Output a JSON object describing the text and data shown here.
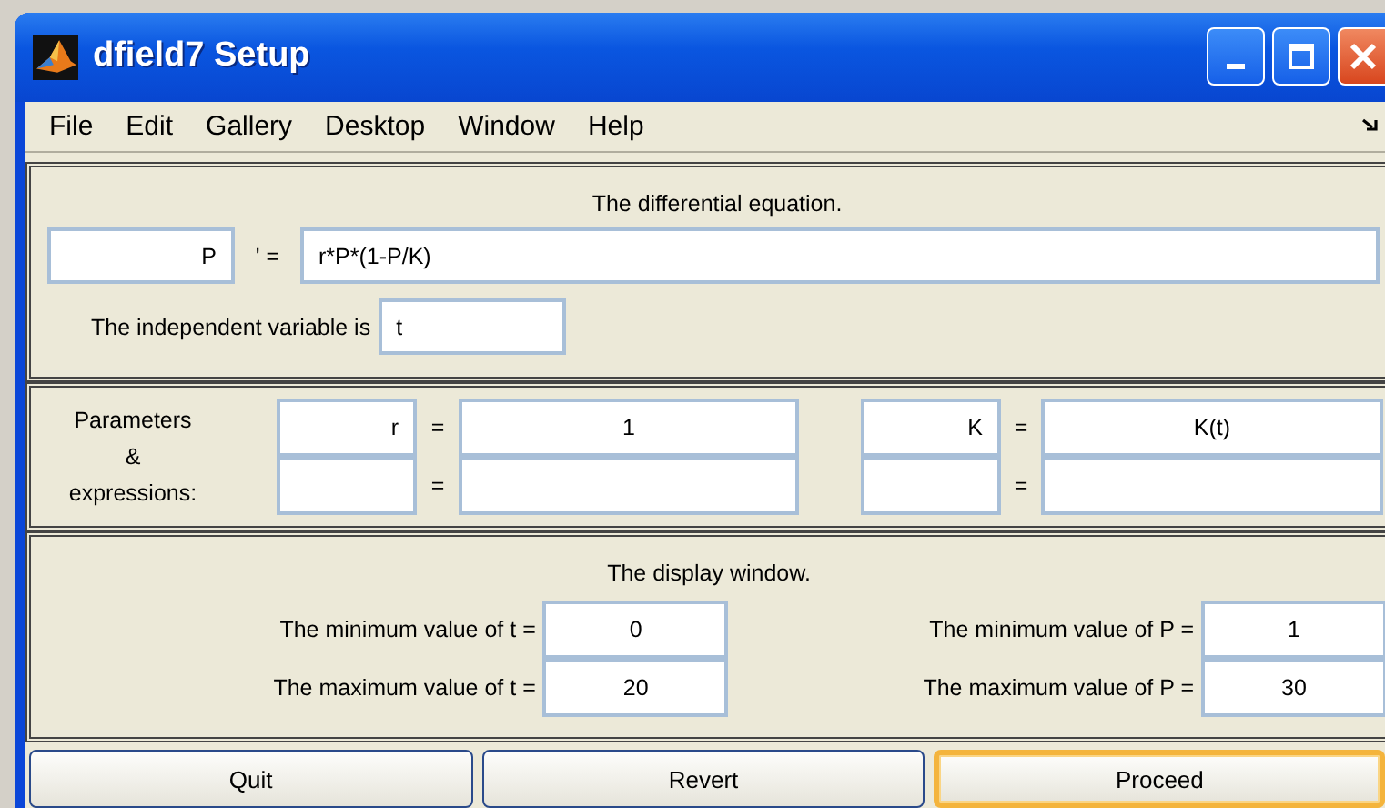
{
  "window": {
    "title": "dfield7 Setup"
  },
  "menu": [
    "File",
    "Edit",
    "Gallery",
    "Desktop",
    "Window",
    "Help"
  ],
  "equation": {
    "title": "The differential equation.",
    "variable": "P",
    "prime": "' =",
    "rhs": "r*P*(1-P/K)",
    "independent_label": "The independent variable is",
    "independent": "t"
  },
  "parameters": {
    "label_1": "Parameters",
    "label_2": "&",
    "label_3": "expressions:",
    "eq": "=",
    "rows": [
      [
        {
          "name": "r",
          "value": "1"
        },
        {
          "name": "K",
          "value": "K(t)"
        }
      ],
      [
        {},
        {}
      ]
    ]
  },
  "display": {
    "title": "The display window.",
    "left": [
      {
        "label": "The minimum value of t =",
        "value": "0"
      },
      {
        "label": "The maximum value of t =",
        "value": "20"
      }
    ],
    "right": [
      {
        "label": "The minimum value of P =",
        "value": "1"
      },
      {
        "label": "The maximum value of P =",
        "value": "30"
      }
    ]
  },
  "buttons": [
    {
      "label": "Quit",
      "default": false
    },
    {
      "label": "Revert",
      "default": false
    },
    {
      "label": "Proceed",
      "default": true
    }
  ]
}
